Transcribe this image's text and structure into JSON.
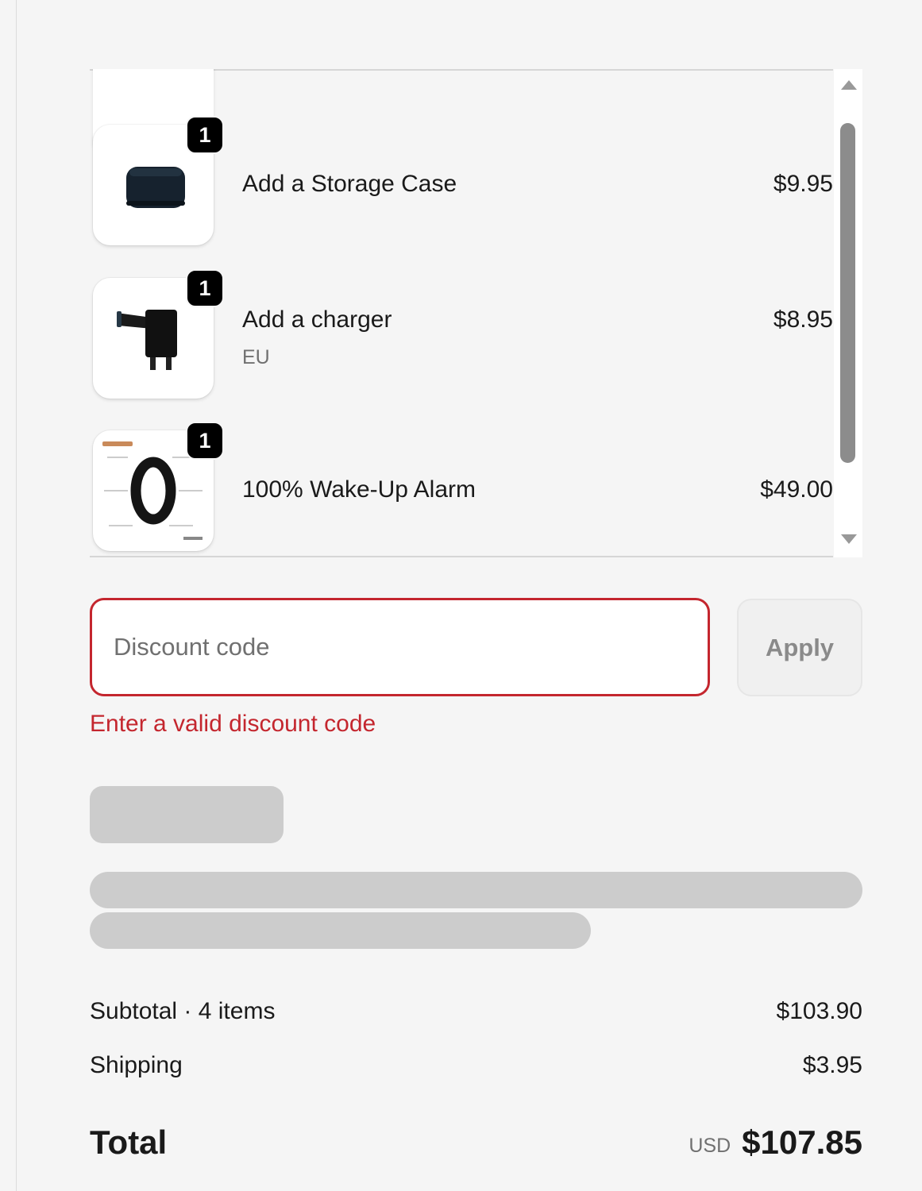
{
  "line_items": [
    {
      "name": "Add a Storage Case",
      "variant": "",
      "price": "$9.95",
      "quantity": "1",
      "image_icon": "storage-case-icon"
    },
    {
      "name": "Add a charger",
      "variant": "EU",
      "price": "$8.95",
      "quantity": "1",
      "image_icon": "charger-icon"
    },
    {
      "name": "100% Wake-Up Alarm",
      "variant": "",
      "price": "$49.00",
      "quantity": "1",
      "image_icon": "alarm-band-icon"
    }
  ],
  "scrollbar": {
    "position": 0.3,
    "visible_fraction": 0.8
  },
  "discount": {
    "placeholder": "Discount code",
    "value": "",
    "apply_label": "Apply",
    "error": "Enter a valid discount code",
    "error_color": "#c4262e"
  },
  "summary": {
    "subtotal_label": "Subtotal · 4 items",
    "subtotal_value": "$103.90",
    "shipping_label": "Shipping",
    "shipping_value": "$3.95",
    "total_label": "Total",
    "currency": "USD",
    "total_value": "$107.85"
  }
}
